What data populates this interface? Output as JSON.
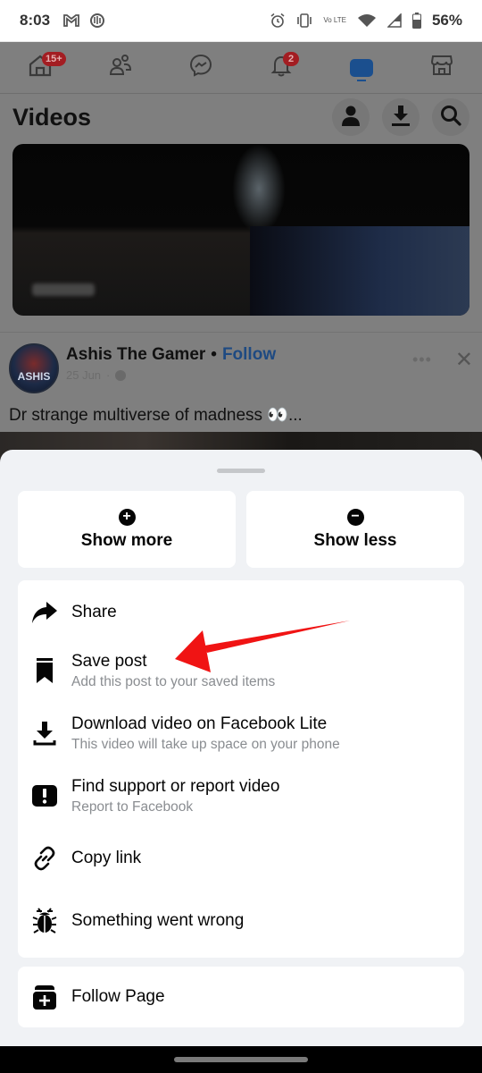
{
  "status_bar": {
    "time": "8:03",
    "left_icons": [
      "gmail-icon",
      "sync-app-icon"
    ],
    "right_icons": [
      "alarm-icon",
      "vibrate-icon",
      "volte-icon",
      "wifi-icon",
      "signal-icon",
      "battery-icon"
    ],
    "volte_label": "Vo LTE",
    "battery_percent": "56%"
  },
  "top_nav": {
    "items": [
      {
        "name": "home",
        "icon": "home-icon",
        "badge": "15+"
      },
      {
        "name": "friends",
        "icon": "friends-icon",
        "badge": ""
      },
      {
        "name": "messenger",
        "icon": "messenger-icon",
        "badge": ""
      },
      {
        "name": "notifications",
        "icon": "bell-icon",
        "badge": "2"
      },
      {
        "name": "video",
        "icon": "video-icon",
        "badge": "",
        "active": true
      },
      {
        "name": "marketplace",
        "icon": "marketplace-icon",
        "badge": ""
      }
    ]
  },
  "videos_header": {
    "title": "Videos",
    "actions": [
      "profile-icon",
      "download-icon",
      "search-icon"
    ]
  },
  "post": {
    "author": "Ashis The Gamer",
    "separator": "•",
    "follow_label": "Follow",
    "date": "25 Jun",
    "date_separator": "·",
    "avatar_text": "ASHIS",
    "text": "Dr strange multiverse of madness 👀..."
  },
  "sheet": {
    "quick_actions": [
      {
        "label": "Show more",
        "icon": "plus-circle-icon",
        "glyph": "+"
      },
      {
        "label": "Show less",
        "icon": "minus-circle-icon",
        "glyph": "−"
      }
    ],
    "menu_items": [
      {
        "title": "Share",
        "subtitle": "",
        "icon": "share-icon"
      },
      {
        "title": "Save post",
        "subtitle": "Add this post to your saved items",
        "icon": "bookmark-icon"
      },
      {
        "title": "Download video on Facebook Lite",
        "subtitle": "This video will take up space on your phone",
        "icon": "download-icon"
      },
      {
        "title": "Find support or report video",
        "subtitle": "Report to Facebook",
        "icon": "report-icon"
      },
      {
        "title": "Copy link",
        "subtitle": "",
        "icon": "link-icon"
      },
      {
        "title": "Something went wrong",
        "subtitle": "",
        "icon": "bug-icon"
      }
    ],
    "follow_page": {
      "title": "Follow Page",
      "icon": "follow-page-icon"
    }
  },
  "annotation": {
    "type": "arrow",
    "color": "#f01414",
    "points_to": "Save post"
  },
  "colors": {
    "brand_blue": "#1877f2",
    "badge_red": "#e41e3f",
    "sheet_bg": "#f0f2f5",
    "secondary_text": "#8a8d91"
  }
}
